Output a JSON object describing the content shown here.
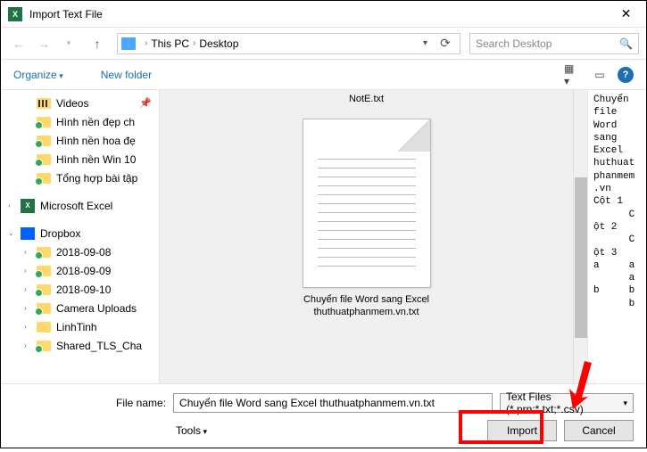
{
  "window": {
    "title": "Import Text File"
  },
  "nav": {
    "breadcrumb": {
      "loc1": "This PC",
      "loc2": "Desktop"
    },
    "search_placeholder": "Search Desktop"
  },
  "toolbar": {
    "organize": "Organize",
    "new_folder": "New folder"
  },
  "sidebar": {
    "items": [
      {
        "label": "Videos",
        "type": "vid",
        "pinned": true
      },
      {
        "label": "Hình nền đẹp ch",
        "type": "fldr"
      },
      {
        "label": "Hình nền hoa đẹ",
        "type": "fldr"
      },
      {
        "label": "Hình nền Win 10",
        "type": "fldr"
      },
      {
        "label": "Tổng hợp bài tập",
        "type": "fldr"
      }
    ],
    "excel_label": "Microsoft Excel",
    "dropbox_label": "Dropbox",
    "dropbox_items": [
      {
        "label": "2018-09-08"
      },
      {
        "label": "2018-09-09"
      },
      {
        "label": "2018-09-10"
      },
      {
        "label": "Camera Uploads"
      },
      {
        "label": "LinhTinh"
      },
      {
        "label": "Shared_TLS_Cha"
      }
    ]
  },
  "files": {
    "top_file": "NotE.txt",
    "selected_file_line1": "Chuyển file Word sang Excel",
    "selected_file_line2": "thuthuatphanmem.vn.txt"
  },
  "preview_text": "Chuyển\nfile\nWord\nsang\nExcel\nhuthuat\nphanmem\n.vn\nCột 1\n      C\nột 2\n      C\nột 3\na     a\n      a\nb     b\n      b",
  "footer": {
    "filename_label": "File name:",
    "filename_value": "Chuyển file Word sang Excel thuthuatphanmem.vn.txt",
    "filter_label": "Text Files (*.prn;*.txt;*.csv)",
    "tools_label": "Tools",
    "import_label": "Import",
    "cancel_label": "Cancel"
  }
}
